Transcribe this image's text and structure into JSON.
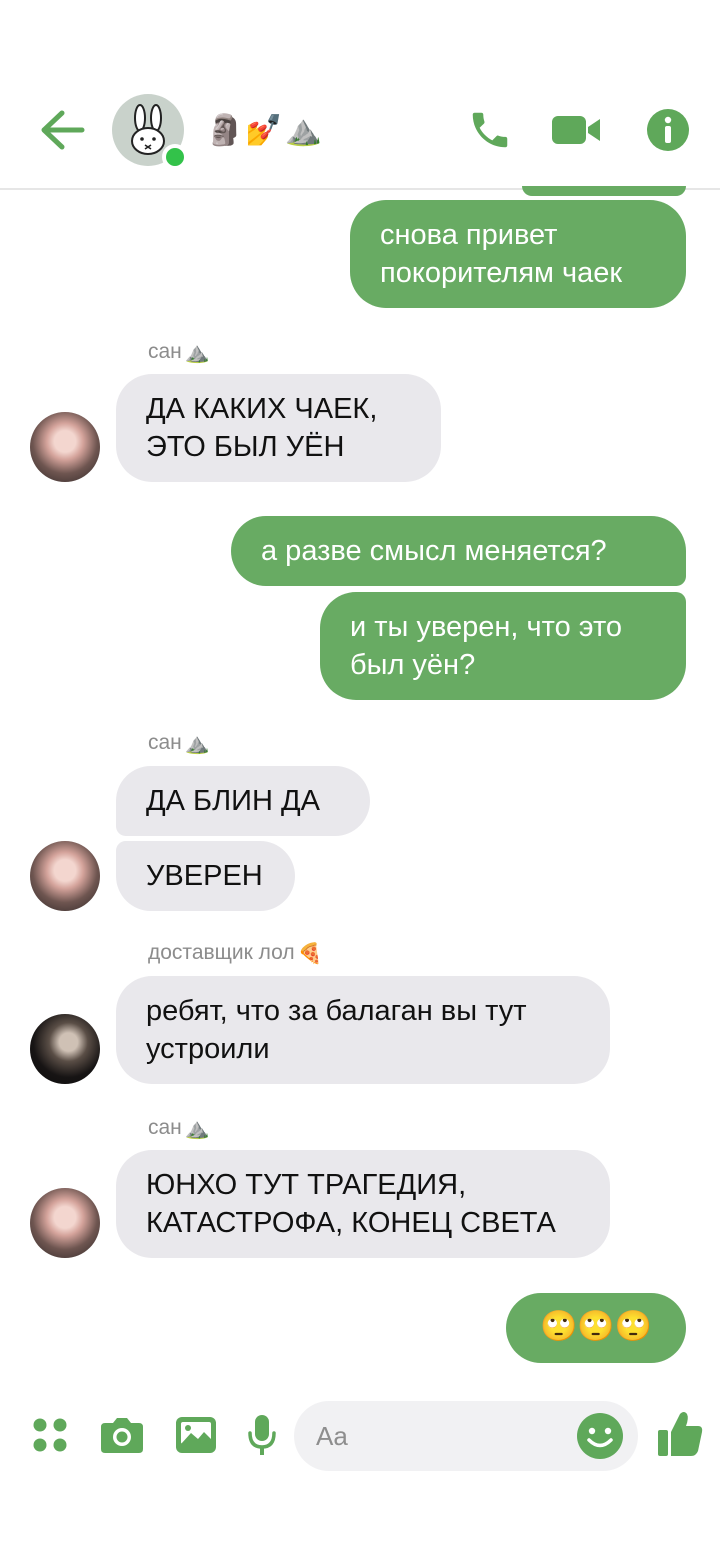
{
  "header": {
    "title_emojis": [
      "🗿",
      "💅",
      "⛰️"
    ],
    "accent": "#5fa85a",
    "online_color": "#33c24a"
  },
  "messages": [
    {
      "text": "снова привет\nпокорителям чаек"
    },
    {
      "sender": "сан",
      "text": "ДА КАКИХ ЧАЕК,\nЭТО БЫЛ УЁН"
    },
    {
      "text": "а разве смысл меняется?"
    },
    {
      "text": "и ты уверен, что это\nбыл уён?"
    },
    {
      "sender": "сан",
      "text": "ДА БЛИН ДА"
    },
    {
      "text": "УВЕРЕН"
    },
    {
      "sender": "доставщик лол",
      "text": "ребят, что за балаган вы тут\nустроили"
    },
    {
      "sender": "сан",
      "text": "ЮНХО ТУТ ТРАГЕДИЯ,\nКАТАСТРОФА, КОНЕЦ СВЕТА"
    },
    {
      "text": "🙄🙄🙄"
    }
  ],
  "composer": {
    "placeholder": "Aa"
  },
  "colors": {
    "outgoing_bubble": "#68ab63",
    "incoming_bubble": "#e9e8ec",
    "sender_text": "#8c8c8c"
  }
}
